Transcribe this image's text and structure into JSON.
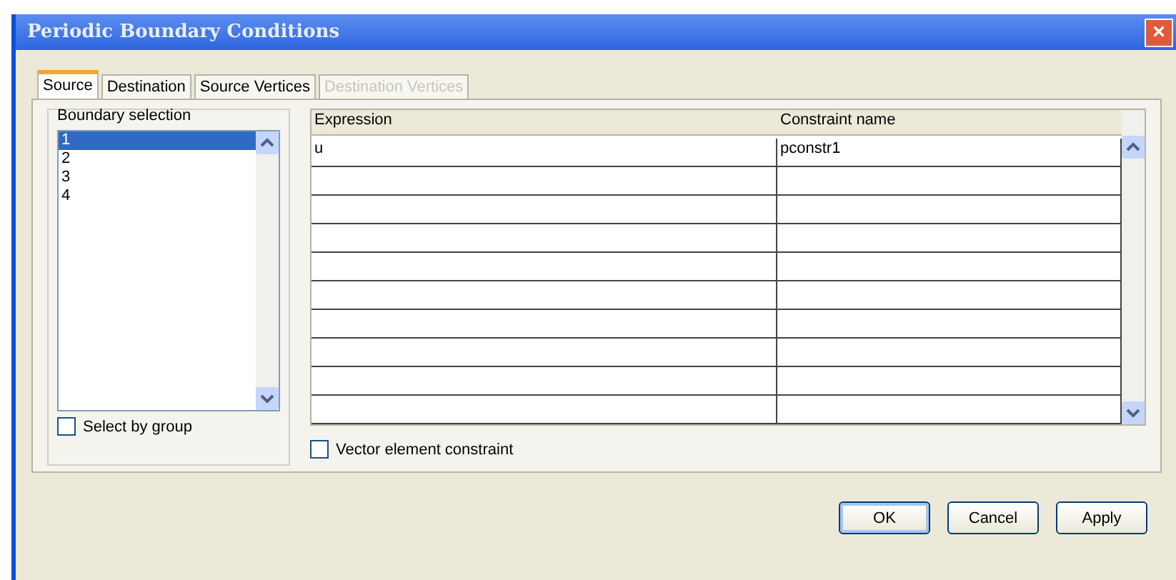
{
  "window": {
    "title": "Periodic Boundary Conditions",
    "close": "×"
  },
  "tabs": [
    {
      "label": "Source",
      "selected": true,
      "disabled": false
    },
    {
      "label": "Destination",
      "selected": false,
      "disabled": false
    },
    {
      "label": "Source Vertices",
      "selected": false,
      "disabled": false
    },
    {
      "label": "Destination Vertices",
      "selected": false,
      "disabled": true
    }
  ],
  "boundary_selection": {
    "title": "Boundary selection",
    "items": [
      {
        "label": "1",
        "selected": true
      },
      {
        "label": "2",
        "selected": false
      },
      {
        "label": "3",
        "selected": false
      },
      {
        "label": "4",
        "selected": false
      }
    ],
    "select_by_group": {
      "label": "Select by group",
      "checked": false
    }
  },
  "table": {
    "columns": [
      "Expression",
      "Constraint name"
    ],
    "rows": [
      {
        "expression": "u",
        "constraint_name": "pconstr1"
      }
    ]
  },
  "vector_element_constraint": {
    "label": "Vector element constraint",
    "checked": false
  },
  "buttons": [
    {
      "label": "OK",
      "default": true
    },
    {
      "label": "Cancel",
      "default": false
    },
    {
      "label": "Apply",
      "default": false
    }
  ]
}
